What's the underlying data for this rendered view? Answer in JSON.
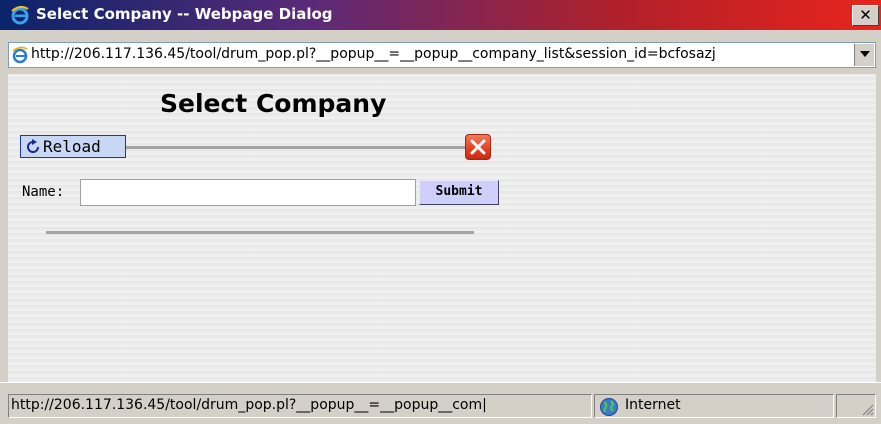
{
  "window": {
    "title": "Select Company -- Webpage Dialog",
    "close_glyph": "✕"
  },
  "address_bar": {
    "url": "http://206.117.136.45/tool/drum_pop.pl?__popup__=__popup__company_list&session_id=bcfosazj",
    "icon": "ie-page-icon"
  },
  "page": {
    "title": "Select Company",
    "reload_label": "Reload",
    "name_label": "Name:",
    "name_value": "",
    "submit_label": "Submit"
  },
  "status_bar": {
    "url": "http://206.117.136.45/tool/drum_pop.pl?__popup__=__popup__com|",
    "zone": "Internet"
  },
  "colors": {
    "accent_blue": "#0a246a",
    "accent_red": "#e8241c",
    "reload_bg": "#c8d8f4",
    "submit_bg": "#cfcffa",
    "close_x": "#e04020"
  }
}
